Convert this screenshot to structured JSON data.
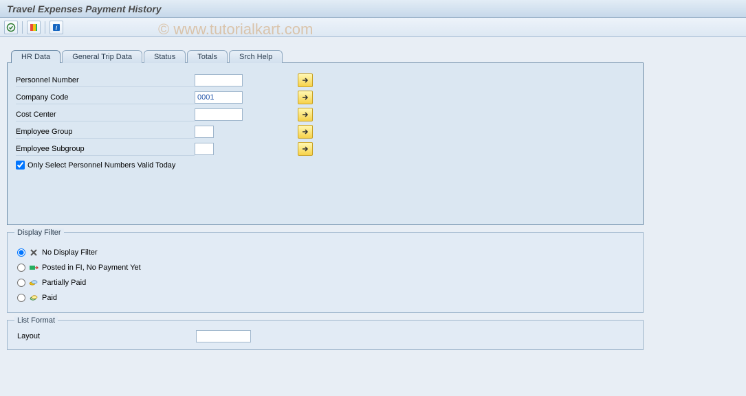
{
  "titlebar": {
    "title": "Travel Expenses Payment History"
  },
  "watermark": "© www.tutorialkart.com",
  "toolbar": {
    "execute_icon": "execute",
    "variant_icon": "variant",
    "info_icon": "info"
  },
  "tabs": [
    {
      "label": "HR Data",
      "active": true
    },
    {
      "label": "General Trip Data",
      "active": false
    },
    {
      "label": "Status",
      "active": false
    },
    {
      "label": "Totals",
      "active": false
    },
    {
      "label": "Srch Help",
      "active": false
    }
  ],
  "hr_data": {
    "fields": [
      {
        "label": "Personnel Number",
        "value": "",
        "size": "md"
      },
      {
        "label": "Company Code",
        "value": "0001",
        "size": "md",
        "highlight": true
      },
      {
        "label": "Cost Center",
        "value": "",
        "size": "md"
      },
      {
        "label": "Employee Group",
        "value": "",
        "size": "sm"
      },
      {
        "label": "Employee Subgroup",
        "value": "",
        "size": "sm"
      }
    ],
    "checkbox_label": "Only Select Personnel Numbers Valid Today",
    "checkbox_checked": true
  },
  "display_filter": {
    "legend": "Display Filter",
    "options": [
      {
        "label": "No Display Filter",
        "icon": "x",
        "checked": true
      },
      {
        "label": "Posted in FI, No Payment Yet",
        "icon": "posted",
        "checked": false
      },
      {
        "label": "Partially Paid",
        "icon": "partial",
        "checked": false
      },
      {
        "label": "Paid",
        "icon": "paid",
        "checked": false
      }
    ]
  },
  "list_format": {
    "legend": "List Format",
    "layout_label": "Layout",
    "layout_value": ""
  }
}
